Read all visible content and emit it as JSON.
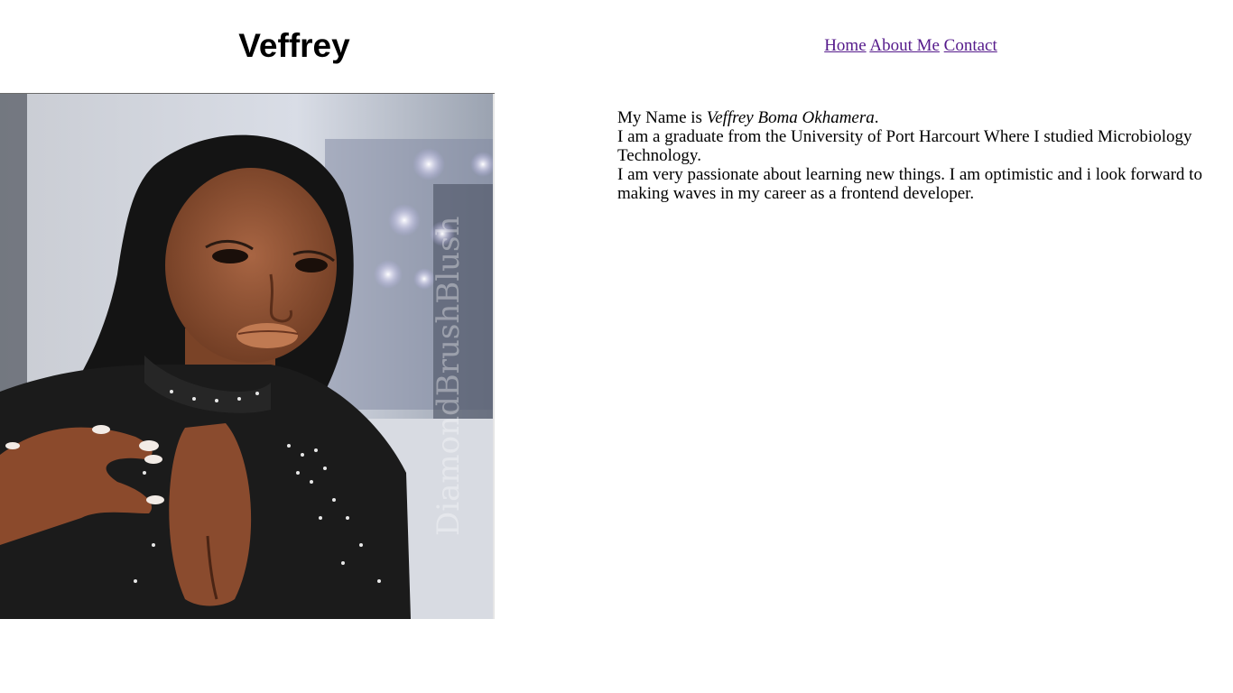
{
  "header": {
    "title": "Veffrey"
  },
  "nav": {
    "links": [
      "Home",
      "About Me",
      "Contact"
    ]
  },
  "photo": {
    "watermark": "DiamondBrushBlush"
  },
  "bio": {
    "name_prefix": "My Name is ",
    "name": "Veffrey Boma Okhamera",
    "name_suffix": ".",
    "line2": "I am a graduate from the University of Port Harcourt Where I studied Microbiology Technology.",
    "line3": "I am very passionate about learning new things. I am optimistic and i look forward to making waves in my career as a frontend developer."
  }
}
